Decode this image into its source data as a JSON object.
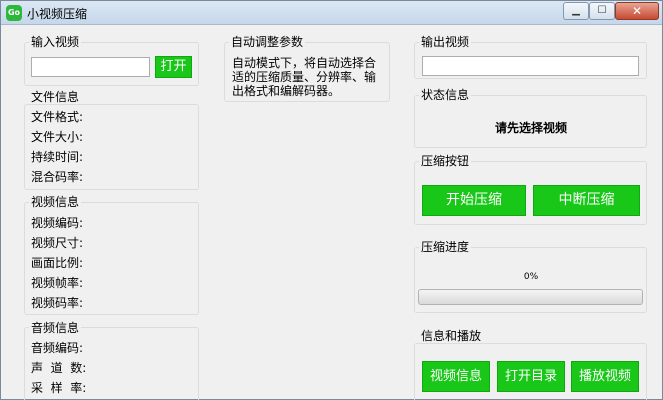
{
  "window": {
    "title": "小视频压缩",
    "app_icon_text": "Go",
    "min_glyph": "▁",
    "max_glyph": "☐",
    "close_glyph": "✕"
  },
  "input_video": {
    "title": "输入视频",
    "path_value": "",
    "open_button": "打开"
  },
  "file_info": {
    "title": "文件信息",
    "labels": [
      "文件格式:",
      "文件大小:",
      "持续时间:",
      "混合码率:"
    ]
  },
  "video_info": {
    "title": "视频信息",
    "labels": [
      "视频编码:",
      "视频尺寸:",
      "画面比例:",
      "视频帧率:",
      "视频码率:"
    ]
  },
  "audio_info": {
    "title": "音频信息",
    "labels": [
      "音频编码:",
      "声  道  数:",
      "采  样  率:"
    ]
  },
  "auto_params": {
    "title": "自动调整参数",
    "description": "自动模式下，将自动选择合适的压缩质量、分辨率、输出格式和编解码器。"
  },
  "output_video": {
    "title": "输出视频",
    "path_value": ""
  },
  "status_info": {
    "title": "状态信息",
    "text": "请先选择视频"
  },
  "compress_buttons": {
    "title": "压缩按钮",
    "start": "开始压缩",
    "stop": "中断压缩"
  },
  "progress": {
    "title": "压缩进度",
    "percent_text": "0%",
    "fraction": 0
  },
  "info_play": {
    "title": "信息和播放",
    "video_info": "视频信息",
    "open_dir": "打开目录",
    "play_video": "播放视频"
  }
}
